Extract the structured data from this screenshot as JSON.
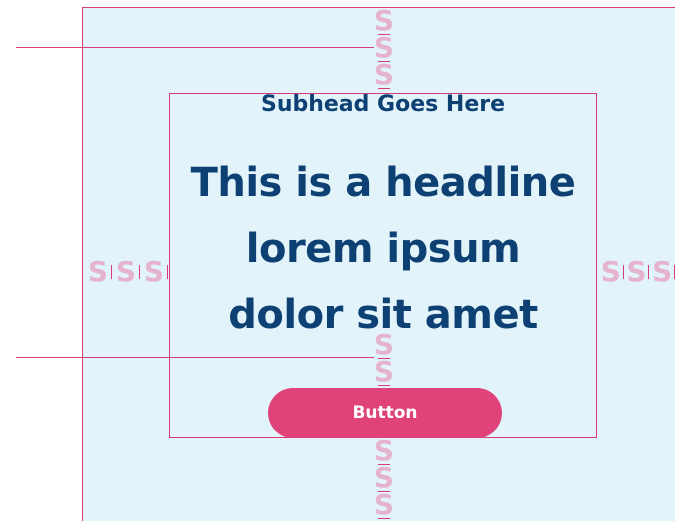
{
  "content": {
    "subhead": "Subhead Goes Here",
    "headline_lines": [
      "This is a headline",
      "lorem ipsum",
      "dolor sit amet"
    ],
    "button_label": "Button"
  },
  "spacing_token": {
    "glyph": "S"
  },
  "colors": {
    "artboard": "#e3f3fa",
    "guide": "#d63b7a",
    "token": "#e6b3cf",
    "text": "#0d4073",
    "button": "#e0437a",
    "button_text": "#ffffff"
  }
}
